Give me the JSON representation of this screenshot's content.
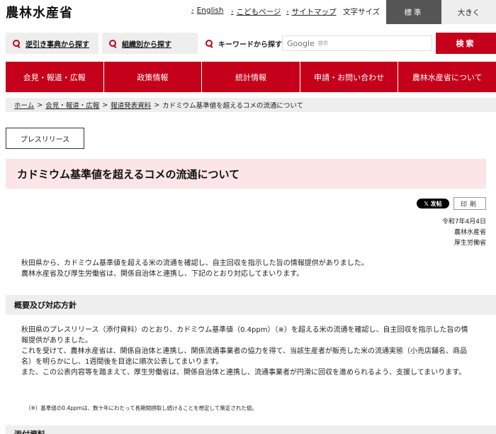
{
  "header": {
    "logo": "農林水産省",
    "links": [
      "English",
      "こどもページ",
      "サイトマップ"
    ],
    "font_size_label": "文字サイズ",
    "font_size_standard": "標準",
    "font_size_large": "大きく"
  },
  "search": {
    "reverse_index": "逆引き事典から探す",
    "by_org": "組織別から探す",
    "keyword_label": "キーワードから探す",
    "google_label": "Google",
    "google_sub": "提供",
    "button": "検索"
  },
  "gnav": [
    "会見・報道・広報",
    "政策情報",
    "統計情報",
    "申請・お問い合わせ",
    "農林水産省について"
  ],
  "breadcrumb": {
    "items": [
      "ホーム",
      "会見・報道・広報",
      "報道発表資料"
    ],
    "current": "カドミウム基準値を超えるコメの流通について"
  },
  "badge": "プレスリリース",
  "title": "カドミウム基準値を超えるコメの流通について",
  "share": {
    "x_post": "𝕏 发帖",
    "print": "印刷"
  },
  "meta": {
    "date": "令和7年4月4日",
    "org1": "農林水産省",
    "org2": "厚生労働省"
  },
  "intro": [
    "秋田県から、カドミウム基準値を超える米の流通を確認し、自主回収を指示した旨の情報提供がありました。",
    "農林水産省及び厚生労働省は、関係自治体と連携し、下記のとおり対応してまいります。"
  ],
  "section": {
    "heading": "概要及び対応方針",
    "paragraphs": [
      "秋田県のプレスリリース（添付資料）のとおり、カドミウム基準値（0.4ppm）（※）を超える米の流通を確認し、自主回収を指示した旨の情報提供がありました。",
      "これを受けて、農林水産省は、関係自治体と連携し、関係流通事業者の協力を得て、当該生産者が販売した米の流通実態（小売店舗名、商品名）を明らかにし、1週間後を目途に順次公表してまいります。",
      "また、この公表内容等を踏まえて、厚生労働省は、関係自治体と連携し、流通事業者が円滑に回収を進められるよう、支援してまいります。"
    ],
    "note": "（※）基準値の0.4ppmは、数十年にわたって長期間摂取し続けることを想定して策定された値。"
  },
  "next_heading": "添付資料"
}
